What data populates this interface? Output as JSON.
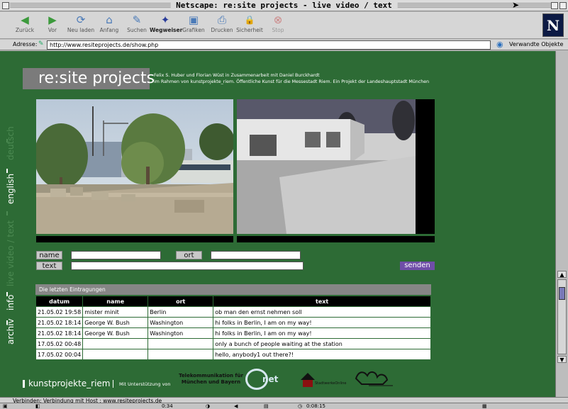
{
  "window": {
    "title": "Netscape: re:site projects - live video / text"
  },
  "toolbar": {
    "buttons": [
      {
        "label": "Zurück",
        "icon": "back-arrow-icon",
        "glyph": "◀"
      },
      {
        "label": "Vor",
        "icon": "forward-arrow-icon",
        "glyph": "▶"
      },
      {
        "label": "Neu laden",
        "icon": "reload-icon",
        "glyph": "⟳"
      },
      {
        "label": "Anfang",
        "icon": "home-icon",
        "glyph": "⌂"
      },
      {
        "label": "Suchen",
        "icon": "search-icon",
        "glyph": "✎"
      },
      {
        "label": "Wegweiser",
        "icon": "guide-icon",
        "glyph": "✦"
      },
      {
        "label": "Grafiken",
        "icon": "images-icon",
        "glyph": "▣"
      },
      {
        "label": "Drucken",
        "icon": "print-icon",
        "glyph": "⎙"
      },
      {
        "label": "Sicherheit",
        "icon": "lock-icon",
        "glyph": "🔒"
      },
      {
        "label": "Stop",
        "icon": "stop-icon",
        "glyph": "⊗"
      }
    ]
  },
  "address": {
    "label": "Adresse:",
    "url": "http://www.resiteprojects.de/show.php",
    "related": "Verwandte Objekte"
  },
  "site": {
    "logo": "re:site projects",
    "credits_line1": "Felix S. Huber und Florian Wüst in Zusammenarbeit mit Daniel Burckhardt",
    "credits_line2": "im Rahmen von kunstprojekte_riem. Öffentliche Kunst für die Messestadt Riem. Ein Projekt der Landeshauptstadt München",
    "nav": [
      {
        "label": "deutsch",
        "active": false
      },
      {
        "label": "english",
        "active": true
      },
      {
        "label": "live video / text",
        "active": false
      },
      {
        "label": "info",
        "active": true
      },
      {
        "label": "archiv",
        "active": true
      }
    ]
  },
  "form": {
    "name_label": "name",
    "ort_label": "ort",
    "text_label": "text",
    "name_value": "",
    "ort_value": "",
    "text_value": "",
    "submit_label": "senden"
  },
  "entries": {
    "title": "Die letzten Eintragungen",
    "columns": [
      "datum",
      "name",
      "ort",
      "text"
    ],
    "rows": [
      [
        "21.05.02 19:58",
        "mister minit",
        "Berlin",
        "ob man den ernst nehmen soll"
      ],
      [
        "21.05.02 18:14",
        "George W. Bush",
        "Washington",
        "hi folks in Berlin, I am on my way!"
      ],
      [
        "21.05.02 18:14",
        "George W. Bush",
        "Washington",
        "hi folks in Berlin, I am on my way!"
      ],
      [
        "17.05.02 00:48",
        "",
        "",
        "only a bunch of people waiting at the station"
      ],
      [
        "17.05.02 00:04",
        "",
        "",
        "hello, anybody1 out there?!"
      ]
    ]
  },
  "footer": {
    "brand": "kunstprojekte_riem",
    "support": "Mit Unterstützung von",
    "sponsor1_line1": "Telekommunikation für",
    "sponsor1_line2": "München und Bayern",
    "sponsor1_suffix": "net",
    "sponsor2": "StadtwerkeOnline"
  },
  "status": {
    "text": "Verbinden: Verbindung mit Host : www.resiteprojects.de",
    "time": "0:34",
    "clock": "0:08:15"
  }
}
